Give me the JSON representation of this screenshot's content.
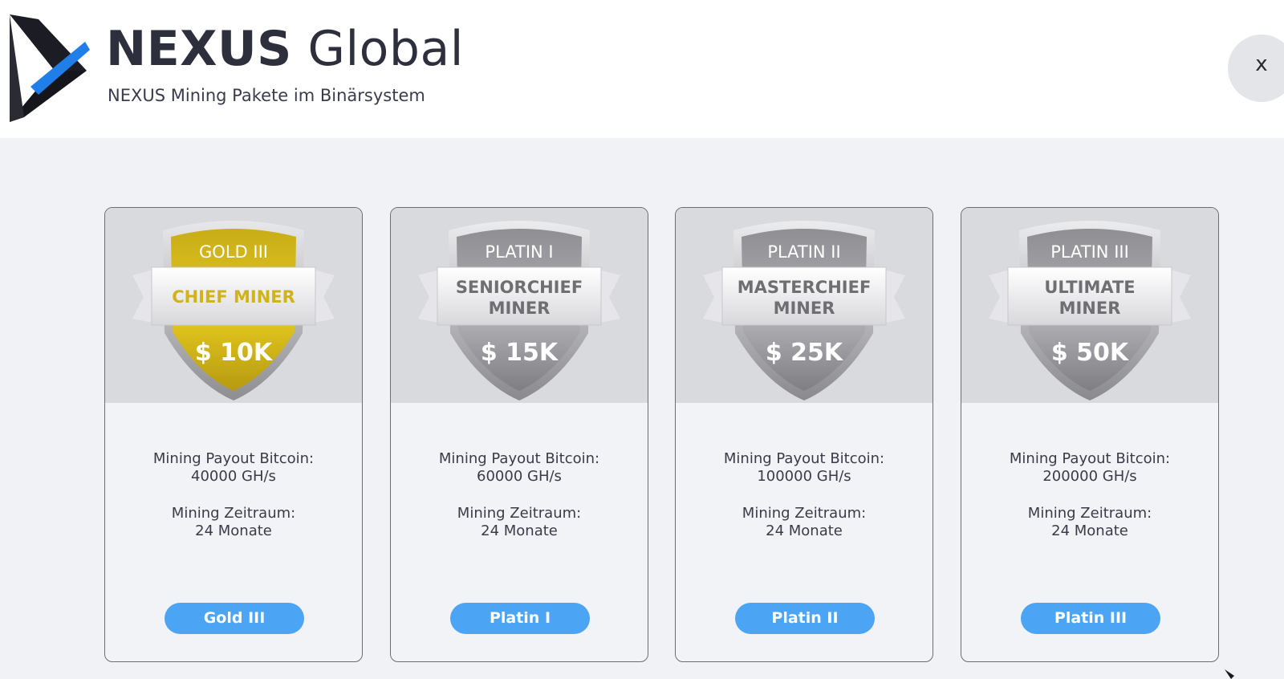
{
  "header": {
    "brand_strong": "NEXUS",
    "brand_light": "Global",
    "subtitle": "NEXUS Mining Pakete im Binärsystem",
    "close_label": "x"
  },
  "colors": {
    "accent_blue": "#4ca4f4",
    "logo_blue": "#1f7ee8",
    "gold": "#d4b81a",
    "silver": "#9c9ba0"
  },
  "packages": [
    {
      "tier": "GOLD III",
      "title_line1": "CHIEF MINER",
      "title_line2": "",
      "price": "$ 10K",
      "payout_label": "Mining Payout Bitcoin:",
      "payout_value": "40000 GH/s",
      "period_label": "Mining Zeitraum:",
      "period_value": "24 Monate",
      "button_label": "Gold III"
    },
    {
      "tier": "PLATIN I",
      "title_line1": "SENIORCHIEF",
      "title_line2": "MINER",
      "price": "$ 15K",
      "payout_label": "Mining Payout Bitcoin:",
      "payout_value": "60000 GH/s",
      "period_label": "Mining Zeitraum:",
      "period_value": "24 Monate",
      "button_label": "Platin I"
    },
    {
      "tier": "PLATIN II",
      "title_line1": "MASTERCHIEF",
      "title_line2": "MINER",
      "price": "$ 25K",
      "payout_label": "Mining Payout Bitcoin:",
      "payout_value": "100000 GH/s",
      "period_label": "Mining Zeitraum:",
      "period_value": "24 Monate",
      "button_label": "Platin II"
    },
    {
      "tier": "PLATIN III",
      "title_line1": "ULTIMATE",
      "title_line2": "MINER",
      "price": "$ 50K",
      "payout_label": "Mining Payout Bitcoin:",
      "payout_value": "200000 GH/s",
      "period_label": "Mining Zeitraum:",
      "period_value": "24 Monate",
      "button_label": "Platin III"
    }
  ]
}
